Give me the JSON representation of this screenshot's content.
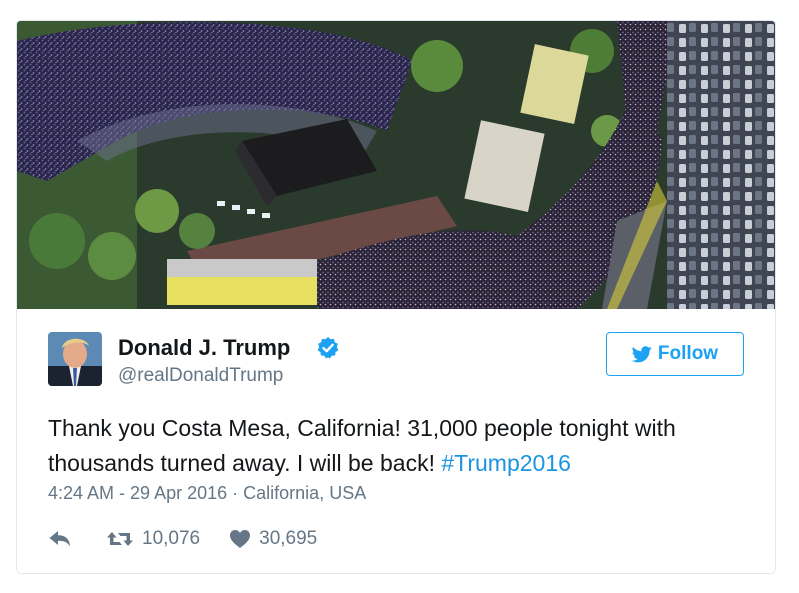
{
  "tweet": {
    "author": {
      "name": "Donald J. Trump",
      "handle": "@realDonaldTrump",
      "verified": true
    },
    "follow_label": "Follow",
    "text_before_hashtag": "Thank you Costa Mesa, California! 31,000 people tonight with thousands turned away. I will be back! ",
    "hashtag": "#Trump2016",
    "timestamp": "4:24 AM - 29 Apr 2016",
    "separator": "·",
    "location": "California, USA",
    "retweets": "10,076",
    "likes": "30,695"
  },
  "colors": {
    "accent": "#1da1f2",
    "link": "#1b95e0",
    "secondary_text": "#657786",
    "border": "#e1e8ed"
  },
  "icons": {
    "verified": "verified-badge-icon",
    "follow": "bird-icon",
    "reply": "reply-arrow-icon",
    "retweet": "retweet-icon",
    "like": "heart-icon"
  }
}
